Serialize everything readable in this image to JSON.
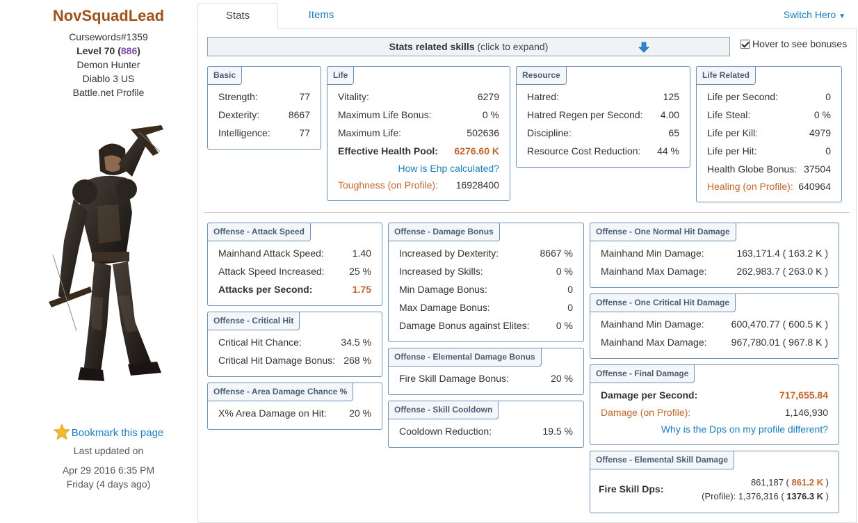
{
  "sidebar": {
    "hero_name": "NovSquadLead",
    "battletag": "Cursewords#1359",
    "level_label": "Level 70 (",
    "paragon": "886",
    "level_close": ")",
    "hero_class": "Demon Hunter",
    "region": "Diablo 3 US",
    "profile_link": "Battle.net Profile",
    "bookmark": "Bookmark this page",
    "last_updated_label": "Last updated on",
    "last_updated_date": "Apr 29 2016 6:35 PM",
    "last_updated_relative": "Friday (4 days ago)"
  },
  "tabs": [
    {
      "label": "Stats"
    },
    {
      "label": "Items"
    }
  ],
  "switch_hero": "Switch Hero",
  "expand_bar": {
    "bold": "Stats related skills",
    "rest": " (click to expand)"
  },
  "hover_bonuses": "Hover to see bonuses",
  "basic": {
    "title": "Basic",
    "rows": [
      {
        "k": "Strength:",
        "v": "77"
      },
      {
        "k": "Dexterity:",
        "v": "8667"
      },
      {
        "k": "Intelligence:",
        "v": "77"
      }
    ]
  },
  "life": {
    "title": "Life",
    "rows": [
      {
        "k": "Vitality:",
        "v": "6279"
      },
      {
        "k": "Maximum Life Bonus:",
        "v": "0 %"
      },
      {
        "k": "Maximum Life:",
        "v": "502636"
      },
      {
        "k": "Effective Health Pool:",
        "v": "6276.60 K"
      }
    ],
    "ehp_link": "How is Ehp calculated?",
    "toughness_label": "Toughness (on Profile):",
    "toughness_value": "16928400"
  },
  "resource": {
    "title": "Resource",
    "rows": [
      {
        "k": "Hatred:",
        "v": "125"
      },
      {
        "k": "Hatred Regen per Second:",
        "v": "4.00"
      },
      {
        "k": "Discipline:",
        "v": "65"
      },
      {
        "k": "Resource Cost Reduction:",
        "v": "44 %"
      }
    ]
  },
  "life_related": {
    "title": "Life Related",
    "rows": [
      {
        "k": "Life per Second:",
        "v": "0"
      },
      {
        "k": "Life Steal:",
        "v": "0 %"
      },
      {
        "k": "Life per Kill:",
        "v": "4979"
      },
      {
        "k": "Life per Hit:",
        "v": "0"
      },
      {
        "k": "Health Globe Bonus:",
        "v": "37504"
      }
    ],
    "healing_label": "Healing (on Profile):",
    "healing_value": "640964"
  },
  "attack_speed": {
    "title": "Offense - Attack Speed",
    "rows": [
      {
        "k": "Mainhand Attack Speed:",
        "v": "1.40"
      },
      {
        "k": "Attack Speed Increased:",
        "v": "25 %"
      },
      {
        "k": "Attacks per Second:",
        "v": "1.75"
      }
    ]
  },
  "critical_hit": {
    "title": "Offense - Critical Hit",
    "rows": [
      {
        "k": "Critical Hit Chance:",
        "v": "34.5 %"
      },
      {
        "k": "Critical Hit Damage Bonus:",
        "v": "268 %"
      }
    ]
  },
  "area_damage": {
    "title": "Offense - Area Damage Chance %",
    "rows": [
      {
        "k": "X% Area Damage on Hit:",
        "v": "20 %"
      }
    ]
  },
  "damage_bonus": {
    "title": "Offense - Damage Bonus",
    "rows": [
      {
        "k": "Increased by Dexterity:",
        "v": "8667 %"
      },
      {
        "k": "Increased by Skills:",
        "v": "0 %"
      },
      {
        "k": "Min Damage Bonus:",
        "v": "0"
      },
      {
        "k": "Max Damage Bonus:",
        "v": "0"
      },
      {
        "k": "Damage Bonus against Elites:",
        "v": "0 %"
      }
    ]
  },
  "elemental_bonus": {
    "title": "Offense - Elemental Damage Bonus",
    "rows": [
      {
        "k": "Fire Skill Damage Bonus:",
        "v": "20 %"
      }
    ]
  },
  "cooldown": {
    "title": "Offense - Skill Cooldown",
    "rows": [
      {
        "k": "Cooldown Reduction:",
        "v": "19.5 %"
      }
    ]
  },
  "normal_hit": {
    "title": "Offense - One Normal Hit Damage",
    "rows": [
      {
        "k": "Mainhand Min Damage:",
        "v": "163,171.4 ( 163.2 K )"
      },
      {
        "k": "Mainhand Max Damage:",
        "v": "262,983.7 ( 263.0 K )"
      }
    ]
  },
  "critical_damage": {
    "title": "Offense - One Critical Hit Damage",
    "rows": [
      {
        "k": "Mainhand Min Damage:",
        "v": "600,470.77 ( 600.5 K )"
      },
      {
        "k": "Mainhand Max Damage:",
        "v": "967,780.01 ( 967.8 K )"
      }
    ]
  },
  "final_damage": {
    "title": "Offense - Final Damage",
    "dps_label": "Damage per Second:",
    "dps_value": "717,655.84",
    "profile_label": "Damage (on Profile):",
    "profile_value": "1,146,930",
    "why_link": "Why is the Dps on my profile different?"
  },
  "elemental_skill": {
    "title": "Offense - Elemental Skill Damage",
    "label": "Fire Skill Dps:",
    "line1_a": "861,187 ( ",
    "line1_b": "861.2 K",
    "line1_c": " )",
    "line2_a": "(Profile): 1,376,316 ( ",
    "line2_b": "1376.3 K",
    "line2_c": " )"
  },
  "colors": {
    "accent_orange": "#c0662e",
    "link_blue": "#1a7fc1",
    "panel_border": "#6f8fb3",
    "paragon_purple": "#7b4fa0"
  }
}
